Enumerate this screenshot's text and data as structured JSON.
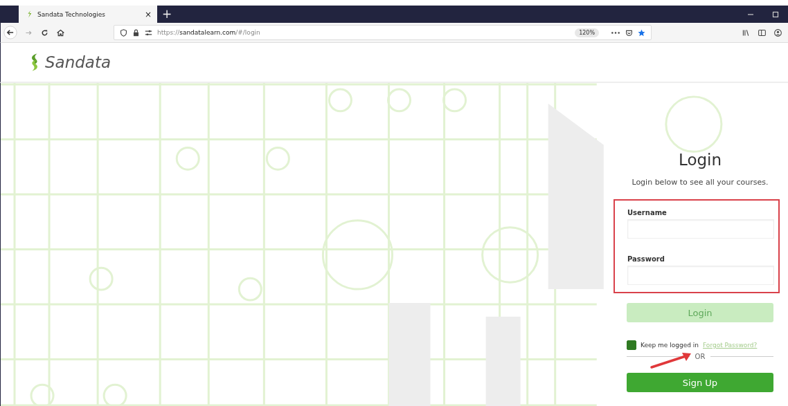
{
  "browser": {
    "tab": {
      "title": "Sandata Technologies",
      "close": "×",
      "selected": true
    },
    "new_tab": "+",
    "url": {
      "scheme": "https://",
      "host": "sandatalearn.com",
      "path": "/#/login"
    },
    "zoom": "120%"
  },
  "header": {
    "logo_text": "Sandata"
  },
  "login": {
    "title": "Login",
    "subtitle": "Login below to see all your courses.",
    "fields": [
      {
        "label": "Username"
      },
      {
        "label": "Password"
      }
    ],
    "login_button": {
      "label": "Login",
      "disabled": true
    },
    "remember": {
      "label": "Keep me logged in",
      "checked": true
    },
    "forgot_link": "Forgot Password?",
    "divider": "OR",
    "signup_button": "Sign Up"
  }
}
